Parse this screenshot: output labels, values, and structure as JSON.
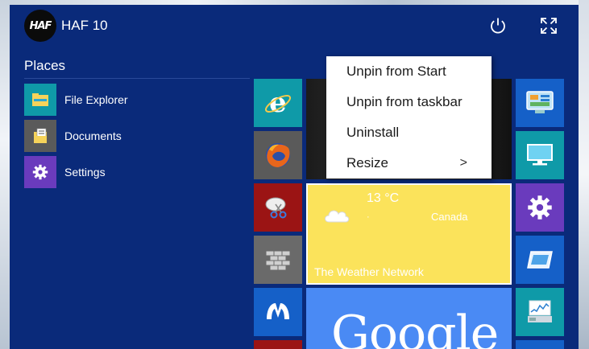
{
  "user": {
    "name": "HAF 10",
    "avatar_text": "HAF"
  },
  "header": {
    "power_icon": "power-icon",
    "expand_icon": "expand-icon"
  },
  "places": {
    "title": "Places",
    "items": [
      {
        "label": "File Explorer",
        "icon": "folder-icon",
        "color": "#0f9aa8"
      },
      {
        "label": "Documents",
        "icon": "documents-icon",
        "color": "#5a5a5a"
      },
      {
        "label": "Settings",
        "icon": "gear-icon",
        "color": "#6a3bbd"
      }
    ]
  },
  "context_menu": {
    "items": [
      {
        "label": "Unpin from Start"
      },
      {
        "label": "Unpin from taskbar"
      },
      {
        "label": "Uninstall"
      },
      {
        "label": "Resize",
        "submenu_arrow": ">"
      }
    ]
  },
  "weather_tile": {
    "temperature": "13 °C",
    "dot": "·",
    "location": "Canada",
    "name": "The Weather Network",
    "color": "#fbe35b"
  },
  "google_tile": {
    "label": "Google",
    "color": "#4a8af4"
  },
  "colors": {
    "start_bg": "#0a2a7a",
    "ie_tile": "#0f9aa8",
    "firefox_tile": "#5a5a5a",
    "snip_tile": "#9b1414",
    "gray_tile": "#6a6a6a",
    "malwarebytes_tile": "#1560c8",
    "right_tile_blue": "#1560c8",
    "right_tile_teal": "#0f9aa8",
    "right_tile_purple": "#6a3bbd"
  }
}
